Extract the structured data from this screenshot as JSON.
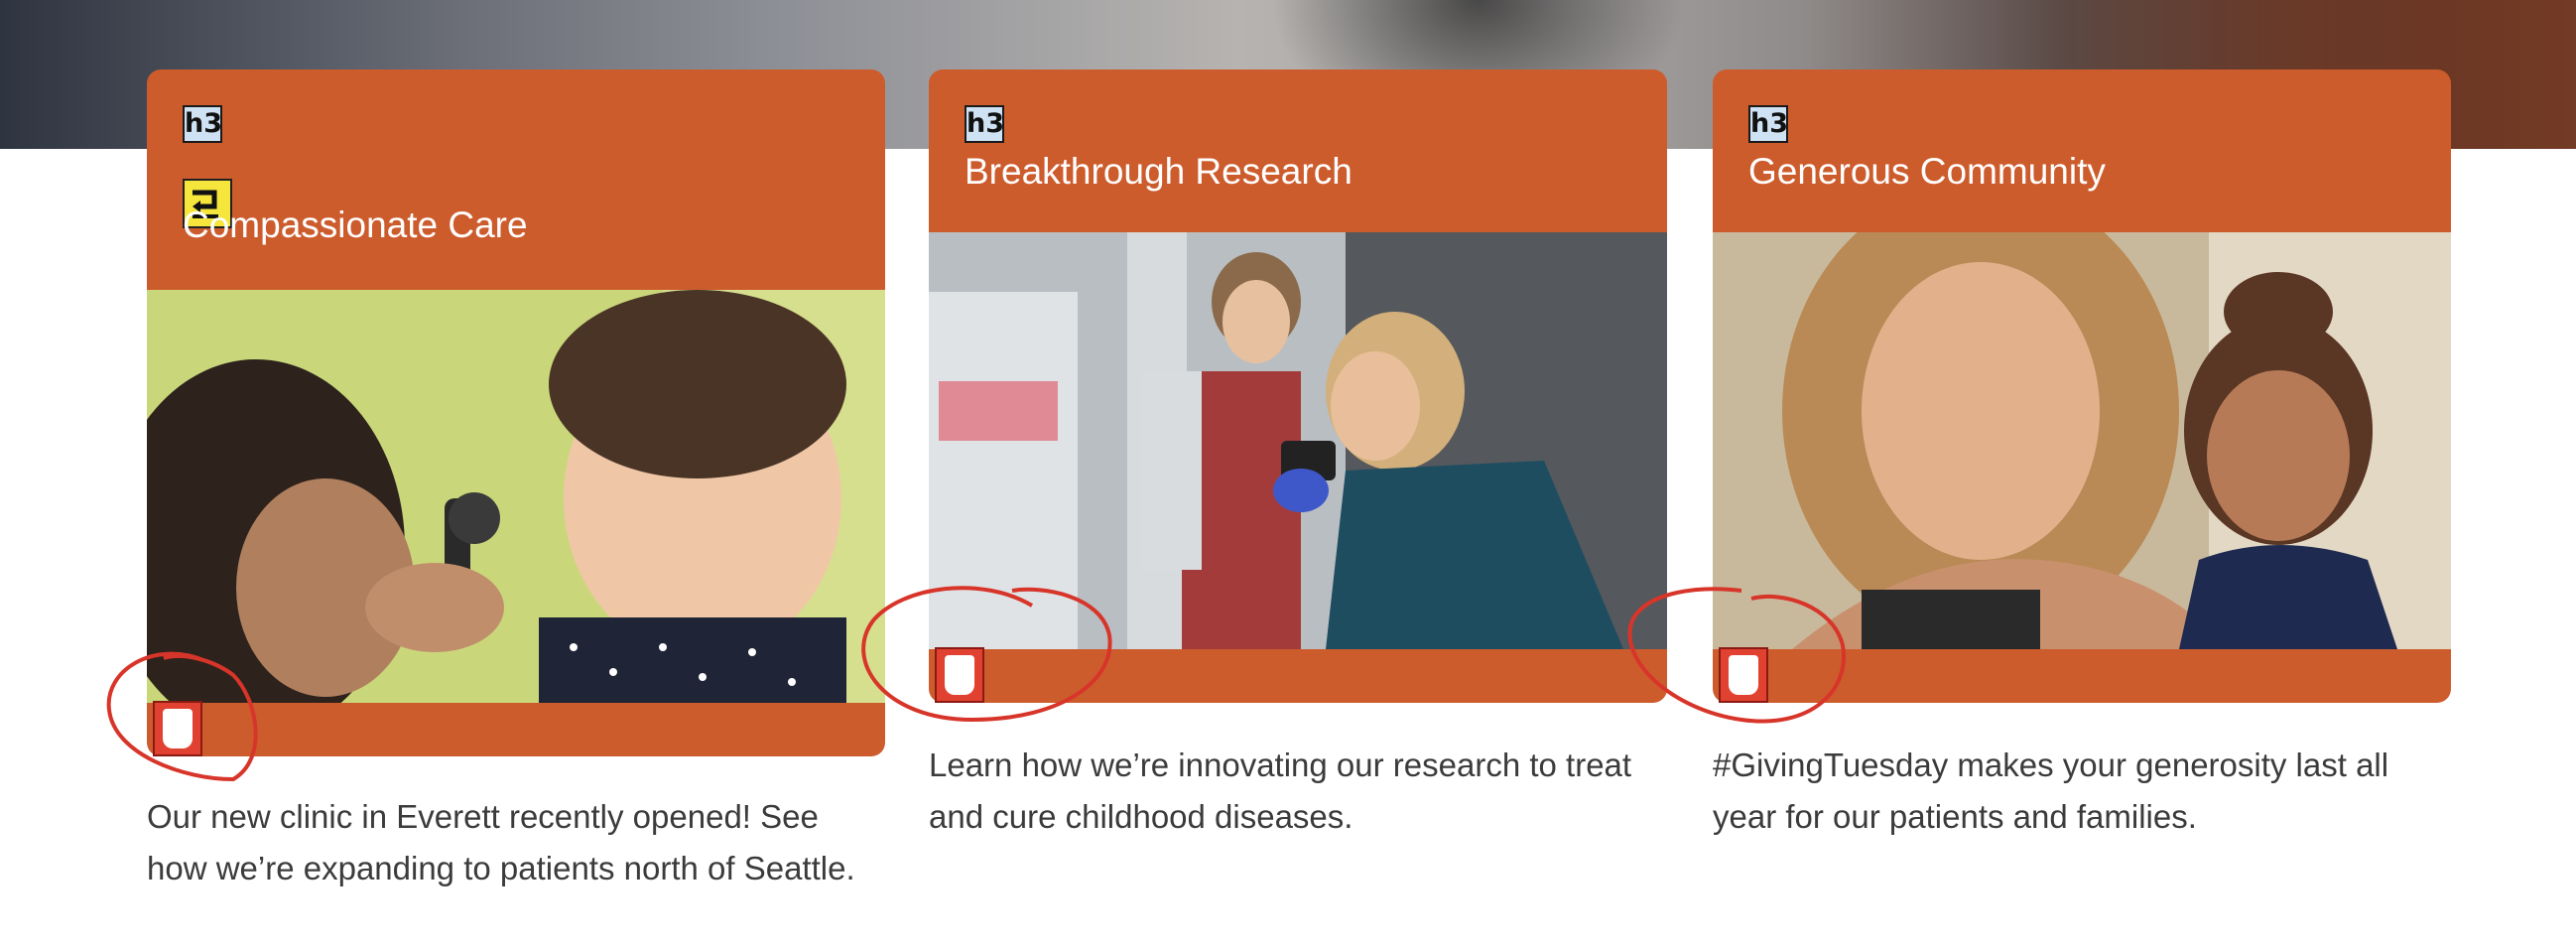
{
  "cards": [
    {
      "heading_tag": "h3",
      "title": "Compassionate Care",
      "description": "Our new clinic in Everett recently opened!  See how we’re expanding to patients north of Seattle."
    },
    {
      "heading_tag": "h3",
      "title": "Breakthrough Research",
      "description": "Learn how we’re innovating our research to treat and cure childhood diseases."
    },
    {
      "heading_tag": "h3",
      "title": "Generous Community",
      "description": "#GivingTuesday makes your generosity last all year for our patients and families."
    }
  ],
  "colors": {
    "accent": "#cd5c2d",
    "annotation": "#d8352a",
    "badge": "#cfe2f3",
    "enter_badge": "#f6e53a"
  },
  "icons": [
    "h3-heading-badge",
    "enter-return-icon",
    "hand-pointer-icon"
  ]
}
